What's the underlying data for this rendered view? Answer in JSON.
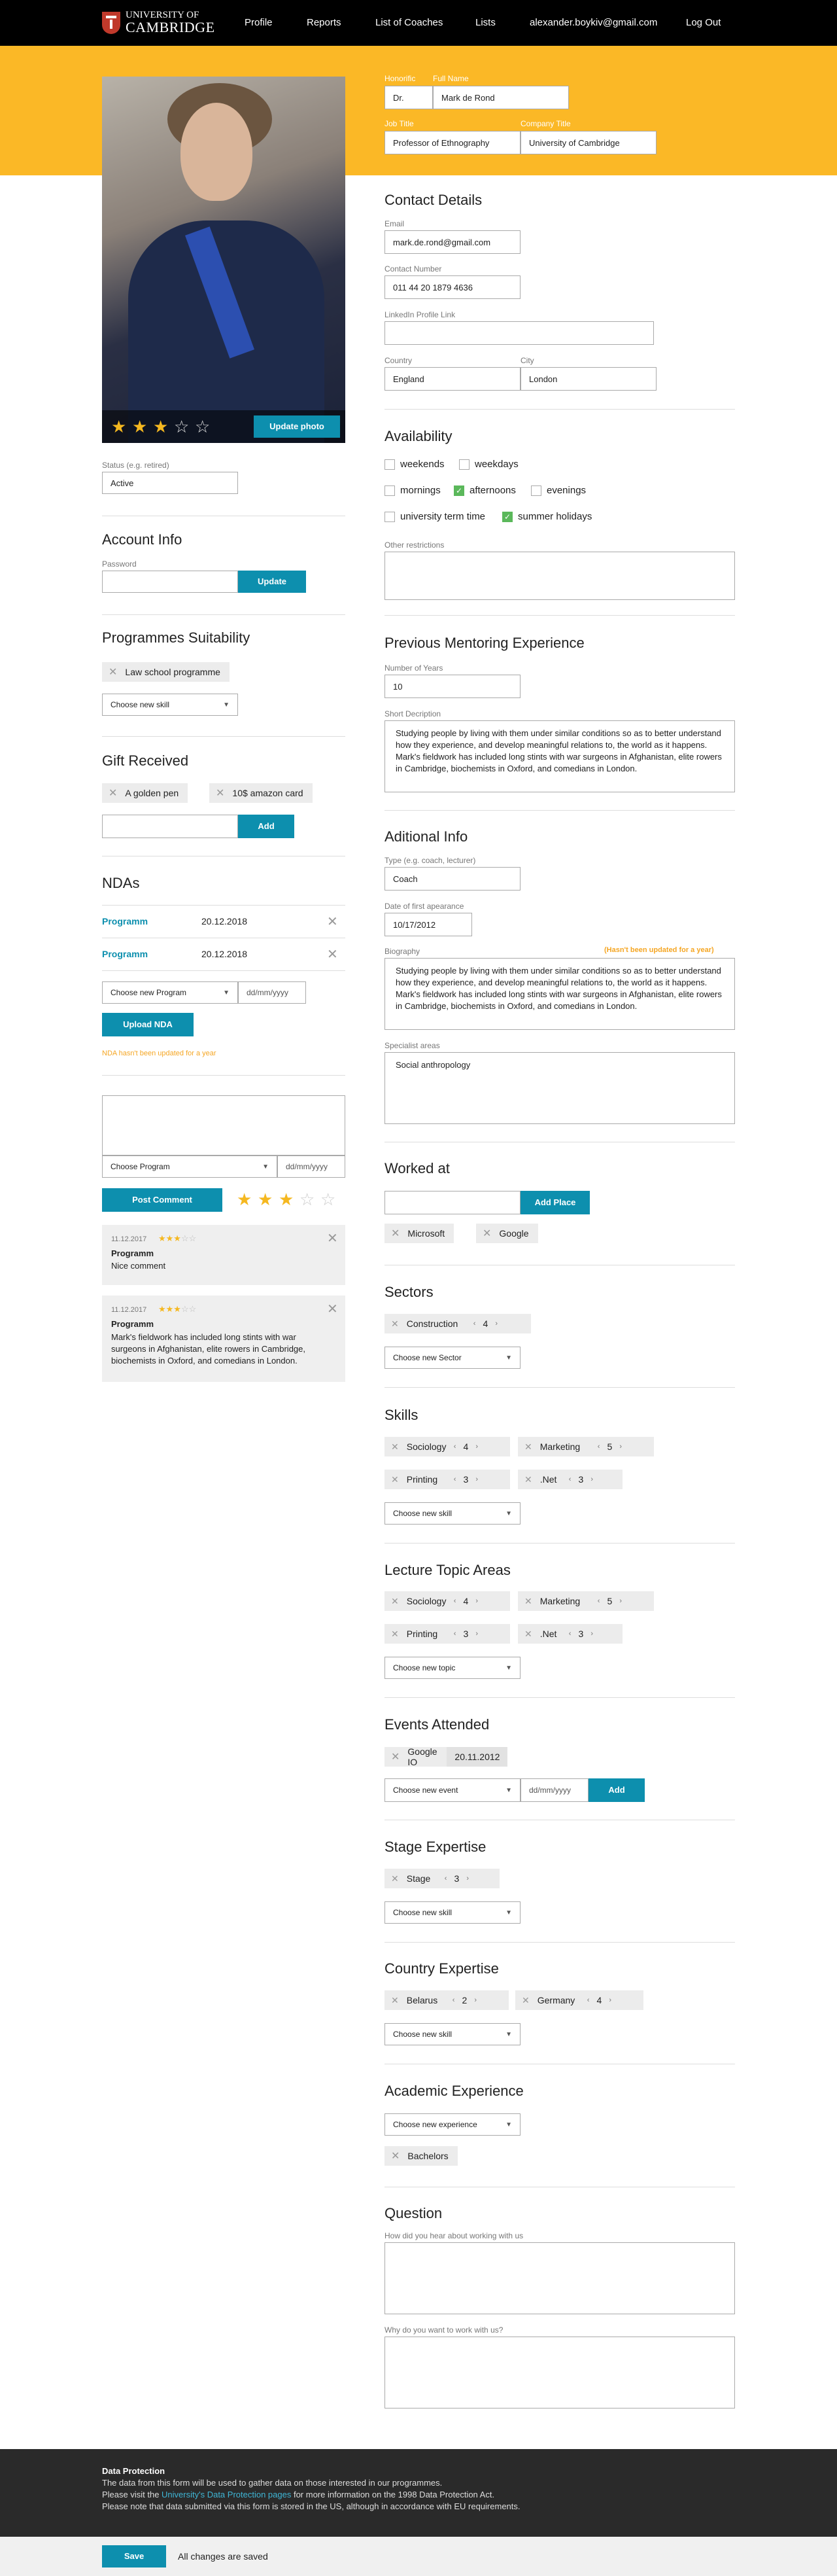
{
  "nav": {
    "logo_line1": "UNIVERSITY OF",
    "logo_line2": "CAMBRIDGE",
    "profile": "Profile",
    "reports": "Reports",
    "coaches": "List of Coaches",
    "lists": "Lists",
    "email": "alexander.boykiv@gmail.com",
    "logout": "Log Out"
  },
  "header": {
    "honorific_label": "Honorific",
    "honorific": "Dr.",
    "fullname_label": "Full Name",
    "fullname": "Mark de Rond",
    "jobtitle_label": "Job Title",
    "jobtitle": "Professor of Ethnography",
    "company_label": "Company Title",
    "company": "University of Cambridge"
  },
  "photo": {
    "rating": 3,
    "max": 5,
    "update_label": "Update photo"
  },
  "status": {
    "label": "Status (e.g. retired)",
    "value": "Active"
  },
  "account": {
    "title": "Account Info",
    "password_label": "Password",
    "update_label": "Update"
  },
  "programmes": {
    "title": "Programmes Suitability",
    "chips": [
      "Law school programme"
    ],
    "select": "Choose new skill"
  },
  "gifts": {
    "title": "Gift Received",
    "chips": [
      "A golden pen",
      "10$ amazon card"
    ],
    "add_label": "Add"
  },
  "ndas": {
    "title": "NDAs",
    "rows": [
      {
        "program": "Programm",
        "date": "20.12.2018"
      },
      {
        "program": "Programm",
        "date": "20.12.2018"
      }
    ],
    "select": "Choose new Program",
    "date_placeholder": "dd/mm/yyyy",
    "upload_label": "Upload NDA",
    "warning": "NDA hasn't been updated for a year"
  },
  "comment_form": {
    "select": "Choose Program",
    "date_placeholder": "dd/mm/yyyy",
    "post_label": "Post Comment",
    "rating": 3
  },
  "comments": [
    {
      "date": "11.12.2017",
      "rating": 3,
      "program": "Programm",
      "text": "Nice comment"
    },
    {
      "date": "11.12.2017",
      "rating": 3,
      "program": "Programm",
      "text": "Mark's fieldwork has included long stints with war surgeons in Afghanistan, elite rowers in Cambridge, biochemists in Oxford, and comedians in London."
    }
  ],
  "contact": {
    "title": "Contact Details",
    "email_label": "Email",
    "email": "mark.de.rond@gmail.com",
    "phone_label": "Contact Number",
    "phone": "011 44 20 1879 4636",
    "linkedin_label": "LinkedIn Profile Link",
    "linkedin": "",
    "country_label": "Country",
    "country": "England",
    "city_label": "City",
    "city": "London"
  },
  "availability": {
    "title": "Availability",
    "options": [
      {
        "label": "weekends",
        "checked": false
      },
      {
        "label": "weekdays",
        "checked": false
      },
      {
        "label": "mornings",
        "checked": false
      },
      {
        "label": "afternoons",
        "checked": true
      },
      {
        "label": "evenings",
        "checked": false
      },
      {
        "label": "university term time",
        "checked": false
      },
      {
        "label": "summer holidays",
        "checked": true
      }
    ],
    "restrictions_label": "Other restrictions"
  },
  "mentoring": {
    "title": "Previous Mentoring Experience",
    "years_label": "Number of Years",
    "years": "10",
    "desc_label": "Short Decription",
    "desc": "Studying people by living with them under similar conditions so as to better understand how they experience, and develop meaningful relations to, the world as it happens. Mark's fieldwork has included long stints with war surgeons in Afghanistan, elite rowers in Cambridge, biochemists in Oxford, and comedians in London."
  },
  "additional": {
    "title": "Aditional Info",
    "type_label": "Type (e.g. coach, lecturer)",
    "type": "Coach",
    "date_label": "Date of first apearance",
    "date": "10/17/2012",
    "bio_label": "Biography",
    "bio_warning": "(Hasn't been updated for a year)",
    "bio": "Studying people by living with them under similar conditions so as to better understand how they experience, and develop meaningful relations to, the world as it happens. Mark's fieldwork has included long stints with war surgeons in Afghanistan, elite rowers in Cambridge, biochemists in Oxford, and comedians in London.",
    "specialist_label": "Specialist areas",
    "specialist": "Social anthropology"
  },
  "worked": {
    "title": "Worked at",
    "add_label": "Add Place",
    "chips": [
      "Microsoft",
      "Google"
    ]
  },
  "sectors": {
    "title": "Sectors",
    "items": [
      {
        "name": "Construction",
        "level": "4"
      }
    ],
    "select": "Choose new Sector"
  },
  "skills": {
    "title": "Skills",
    "items": [
      {
        "name": "Sociology",
        "level": "4"
      },
      {
        "name": "Marketing",
        "level": "5"
      },
      {
        "name": "Printing",
        "level": "3"
      },
      {
        "name": ".Net",
        "level": "3"
      }
    ],
    "select": "Choose new skill"
  },
  "lecture": {
    "title": "Lecture Topic Areas",
    "items": [
      {
        "name": "Sociology",
        "level": "4"
      },
      {
        "name": "Marketing",
        "level": "5"
      },
      {
        "name": "Printing",
        "level": "3"
      },
      {
        "name": ".Net",
        "level": "3"
      }
    ],
    "select": "Choose new topic"
  },
  "events": {
    "title": "Events Attended",
    "items": [
      {
        "name": "Google IO",
        "date": "20.11.2012"
      }
    ],
    "select": "Choose new event",
    "date_placeholder": "dd/mm/yyyy",
    "add_label": "Add"
  },
  "stage": {
    "title": "Stage Expertise",
    "items": [
      {
        "name": "Stage",
        "level": "3"
      }
    ],
    "select": "Choose new skill"
  },
  "country_exp": {
    "title": "Country Expertise",
    "items": [
      {
        "name": "Belarus",
        "level": "2"
      },
      {
        "name": "Germany",
        "level": "4"
      }
    ],
    "select": "Choose new skill"
  },
  "academic": {
    "title": "Academic Experience",
    "select": "Choose new experience",
    "chips": [
      "Bachelors"
    ]
  },
  "question": {
    "title": "Question",
    "q1": "How did you hear about working with us",
    "q2": "Why do you want to work with us?"
  },
  "footer": {
    "title": "Data Protection",
    "line1": "The data from this form will be used to gather data on those interested in our programmes.",
    "line2_pre": "Please visit the ",
    "line2_link": "University's Data Protection pages",
    "line2_post": " for more information on the 1998 Data Protection Act.",
    "line3": "Please note that data submitted via this form is stored in the US, although in accordance with EU requirements."
  },
  "bottom": {
    "save_label": "Save",
    "status": "All changes are saved"
  },
  "colors": {
    "accent": "#0d8fae",
    "yellow": "#fbb826",
    "star": "#f5b820",
    "check": "#5bb85b"
  }
}
